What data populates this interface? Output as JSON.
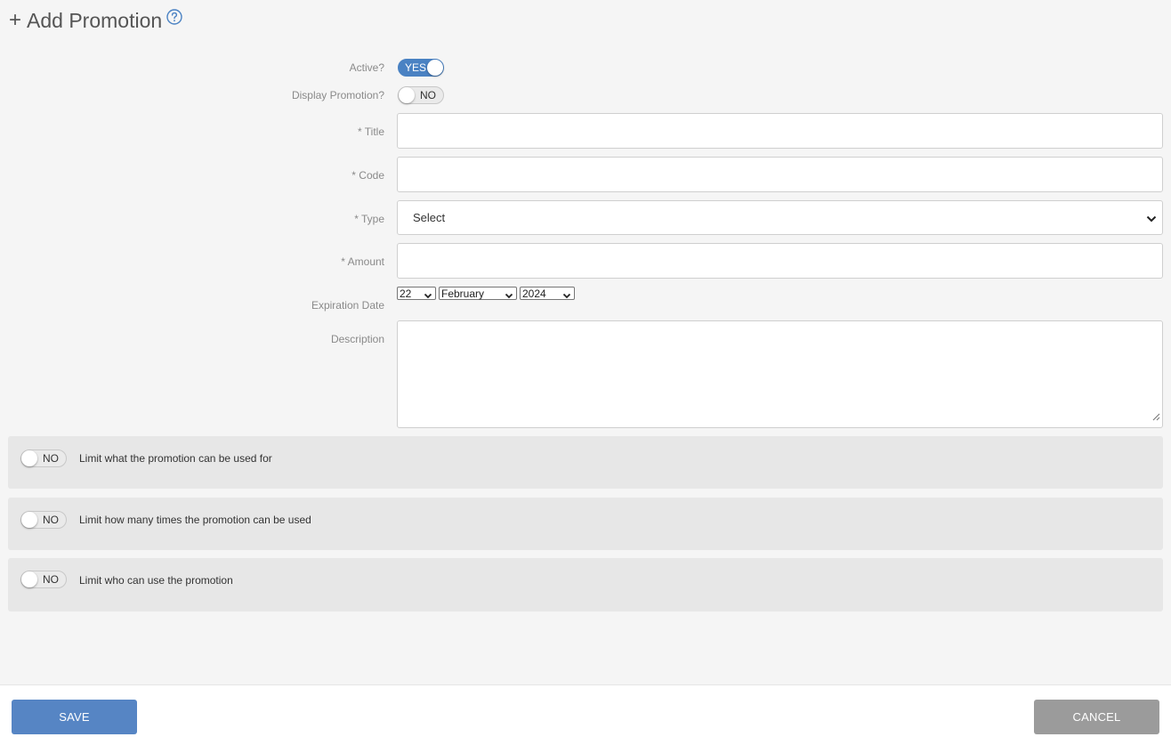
{
  "header": {
    "plus": "+",
    "title": "Add Promotion",
    "help_icon": "question-circle-icon"
  },
  "form": {
    "active": {
      "label": "Active?",
      "value": "YES",
      "on": true
    },
    "display_promotion": {
      "label": "Display Promotion?",
      "value": "NO",
      "on": false
    },
    "title": {
      "label": "* Title",
      "value": ""
    },
    "code": {
      "label": "* Code",
      "value": ""
    },
    "type": {
      "label": "* Type",
      "selected": "Select"
    },
    "amount": {
      "label": "* Amount",
      "value": ""
    },
    "expiration_date": {
      "label": "Expiration Date",
      "day": "22",
      "month": "February",
      "year": "2024"
    },
    "description": {
      "label": "Description",
      "value": ""
    }
  },
  "limits": [
    {
      "toggle": "NO",
      "label": "Limit what the promotion can be used for"
    },
    {
      "toggle": "NO",
      "label": "Limit how many times the promotion can be used"
    },
    {
      "toggle": "NO",
      "label": "Limit who can use the promotion"
    }
  ],
  "footer": {
    "save_label": "SAVE",
    "cancel_label": "CANCEL"
  },
  "colors": {
    "accent": "#4a82c3",
    "save": "#5685c4",
    "cancel": "#9b9b9b",
    "panel": "#e7e7e7",
    "background": "#f5f5f5"
  }
}
